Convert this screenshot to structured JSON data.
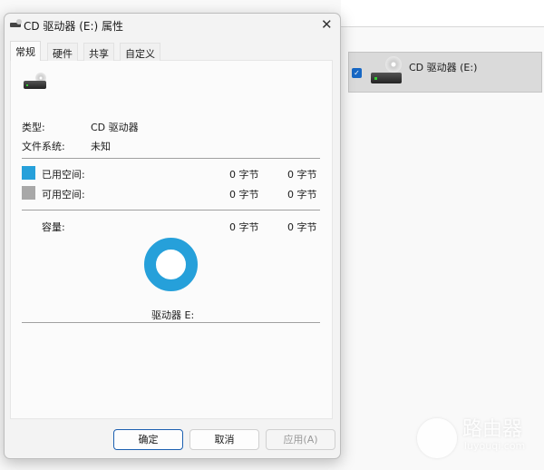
{
  "explorer": {
    "selected_item": "CD 驱动器 (E:)"
  },
  "dialog": {
    "title": "CD 驱动器 (E:) 属性",
    "tabs": [
      "常规",
      "硬件",
      "共享",
      "自定义"
    ],
    "type_label": "类型:",
    "type_value": "CD 驱动器",
    "fs_label": "文件系统:",
    "fs_value": "未知",
    "used_label": "已用空间:",
    "used_bytes": "0 字节",
    "used_size": "0 字节",
    "free_label": "可用空间:",
    "free_bytes": "0 字节",
    "free_size": "0 字节",
    "capacity_label": "容量:",
    "capacity_bytes": "0 字节",
    "capacity_size": "0 字节",
    "drive_label": "驱动器 E:",
    "buttons": {
      "ok": "确定",
      "cancel": "取消",
      "apply": "应用(A)"
    }
  },
  "colors": {
    "used": "#26a0da",
    "free": "#a8a8a8"
  },
  "watermark": {
    "title": "路由器",
    "url": "luyouqi.com"
  }
}
